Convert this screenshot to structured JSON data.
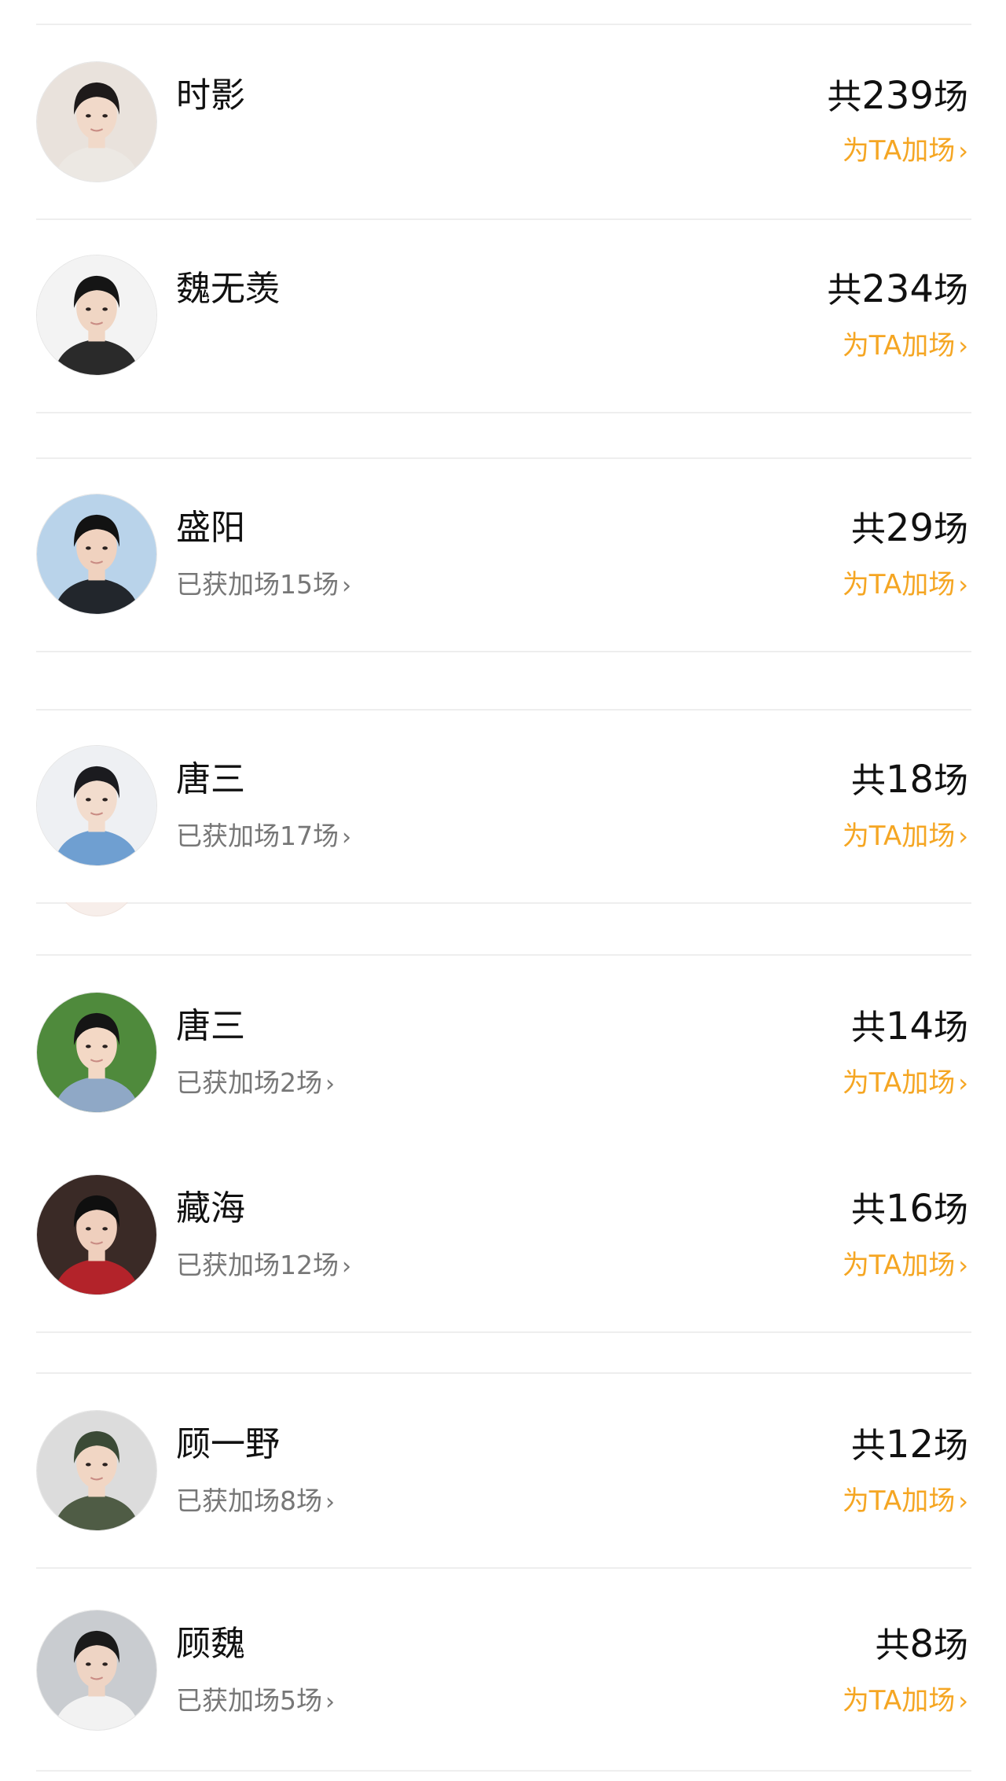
{
  "list": {
    "items": [
      {
        "name": "时影",
        "total_prefix": "共",
        "total_count": "239",
        "total_suffix": "场",
        "boost_label": "为TA加场",
        "earned": "",
        "avatar_colors": {
          "bg": "#e9e2dc",
          "hair": "#1e1a1a",
          "skin": "#f1d9c9",
          "cloth": "#ece8e3"
        }
      },
      {
        "name": "魏无羡",
        "total_prefix": "共",
        "total_count": "234",
        "total_suffix": "场",
        "boost_label": "为TA加场",
        "earned": "",
        "avatar_colors": {
          "bg": "#f3f3f3",
          "hair": "#151515",
          "skin": "#f0d6c4",
          "cloth": "#2a2a2a"
        }
      },
      {
        "name": "盛阳",
        "total_prefix": "共",
        "total_count": "29",
        "total_suffix": "场",
        "boost_label": "为TA加场",
        "earned": "已获加场15场",
        "avatar_colors": {
          "bg": "#b9d3ea",
          "hair": "#121212",
          "skin": "#f0d2bf",
          "cloth": "#22262c"
        }
      },
      {
        "name": "唐三",
        "total_prefix": "共",
        "total_count": "18",
        "total_suffix": "场",
        "boost_label": "为TA加场",
        "earned": "已获加场17场",
        "avatar_colors": {
          "bg": "#eef0f3",
          "hair": "#1b1b1f",
          "skin": "#f2dccd",
          "cloth": "#6f9fd1"
        }
      },
      {
        "name": "唐三",
        "total_prefix": "共",
        "total_count": "14",
        "total_suffix": "场",
        "boost_label": "为TA加场",
        "earned": "已获加场2场",
        "avatar_colors": {
          "bg": "#4f8a3c",
          "hair": "#151515",
          "skin": "#f3d8c5",
          "cloth": "#8fa8c6"
        }
      },
      {
        "name": "藏海",
        "total_prefix": "共",
        "total_count": "16",
        "total_suffix": "场",
        "boost_label": "为TA加场",
        "earned": "已获加场12场",
        "avatar_colors": {
          "bg": "#3a2a26",
          "hair": "#0f0f0f",
          "skin": "#efcfbd",
          "cloth": "#b3232a"
        }
      },
      {
        "name": "顾一野",
        "total_prefix": "共",
        "total_count": "12",
        "total_suffix": "场",
        "boost_label": "为TA加场",
        "earned": "已获加场8场",
        "avatar_colors": {
          "bg": "#dcdcdc",
          "hair": "#3b4a36",
          "skin": "#f1d6c4",
          "cloth": "#4f5c45"
        }
      },
      {
        "name": "顾魏",
        "total_prefix": "共",
        "total_count": "8",
        "total_suffix": "场",
        "boost_label": "为TA加场",
        "earned": "已获加场5场",
        "avatar_colors": {
          "bg": "#c9ccd0",
          "hair": "#1a1a1a",
          "skin": "#eed4c4",
          "cloth": "#f2f2f2"
        }
      }
    ]
  },
  "icons": {
    "chevron": "›"
  },
  "colors": {
    "accent": "#f5a623",
    "text": "#111111",
    "muted": "#777777",
    "divider": "#eeeeee"
  }
}
